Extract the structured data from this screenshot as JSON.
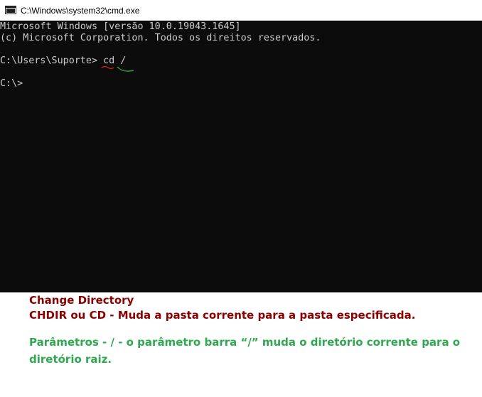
{
  "window": {
    "title": "C:\\Windows\\system32\\cmd.exe",
    "icon": "cmd-icon"
  },
  "console": {
    "lines": [
      "Microsoft Windows [versão 10.0.19043.1645]",
      "(c) Microsoft Corporation. Todos os direitos reservados.",
      "C:\\Users\\Suporte> cd /",
      "C:\\>"
    ],
    "text_color": "#cccccc",
    "background": "#0c0c0c"
  },
  "notes": {
    "heading": "Change Directory",
    "description": "CHDIR ou CD - Muda a pasta corrente para a pasta especificada.",
    "param_line1": "Parâmetros - / - o parâmetro barra “/” muda o diretório corrente para o",
    "param_line2": "diretório raiz.",
    "heading_color": "#8b0000",
    "param_color": "#2fa84f"
  }
}
